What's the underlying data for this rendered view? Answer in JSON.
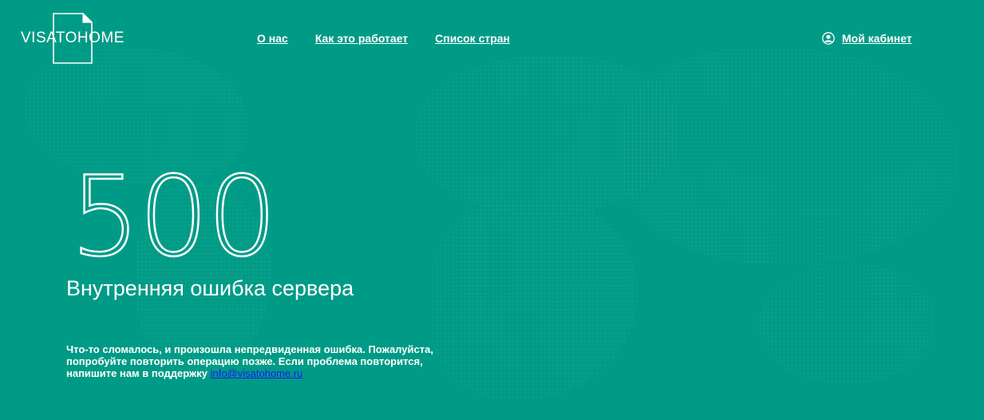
{
  "header": {
    "logo_text": "VISATOHOME",
    "nav": [
      {
        "label": "О нас"
      },
      {
        "label": "Как это работает"
      },
      {
        "label": "Список стран"
      }
    ],
    "cabinet_label": "Мой кабинет"
  },
  "error": {
    "code": "500",
    "title": "Внутренняя ошибка сервера",
    "message": "Что-то сломалось, и произошла непредвиденная ошибка. Пожалуйста, попробуйте повторить операцию позже. Если проблема повторится, напишите нам в поддержку",
    "support_email": "info@visatohome.ru"
  },
  "colors": {
    "background": "#009b86",
    "text": "#ffffff",
    "link": "#1a1aff"
  },
  "icons": {
    "logo": "document-outline-icon",
    "cabinet": "user-circle-icon"
  }
}
